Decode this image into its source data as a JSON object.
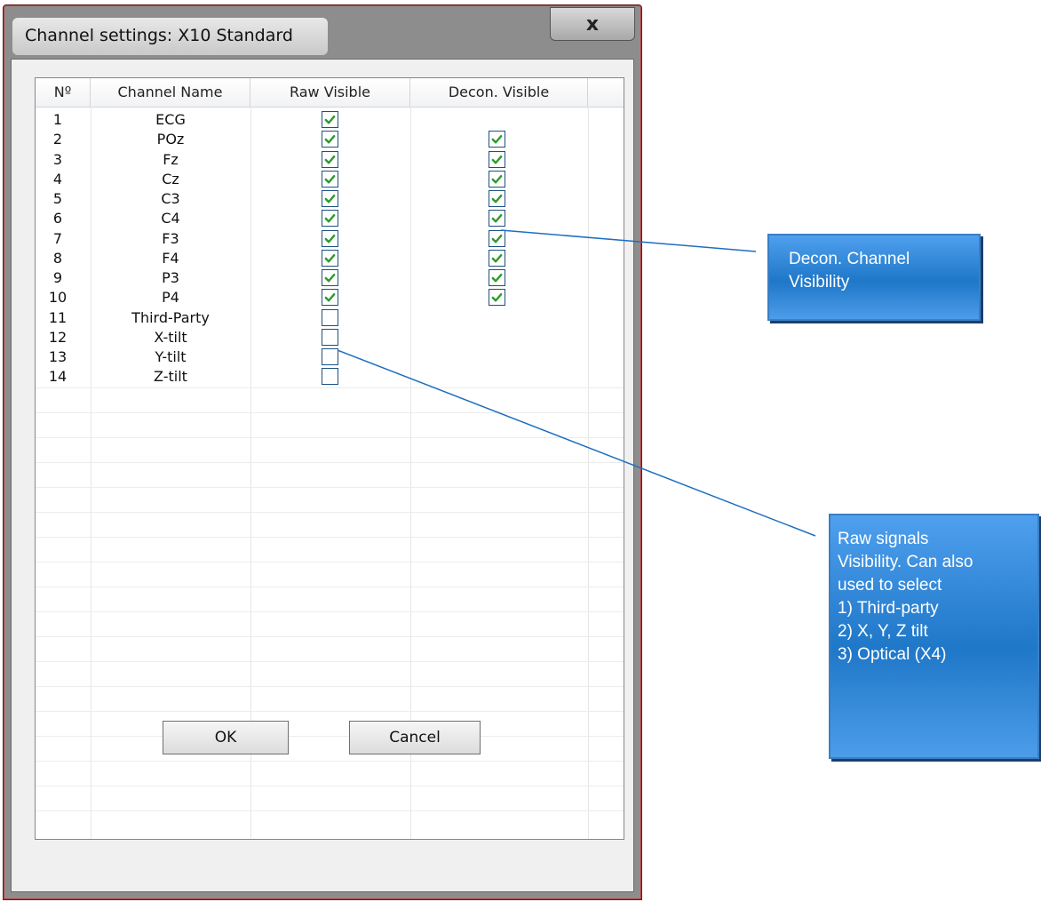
{
  "dialog": {
    "title": "Channel settings: X10 Standard",
    "close_label": "x",
    "ok_label": "OK",
    "cancel_label": "Cancel"
  },
  "table": {
    "columns": [
      "Nº",
      "Channel Name",
      "Raw Visible",
      "Decon. Visible"
    ],
    "rows": [
      {
        "num": "1",
        "name": "ECG",
        "raw": true,
        "decon": null
      },
      {
        "num": "2",
        "name": "POz",
        "raw": true,
        "decon": true
      },
      {
        "num": "3",
        "name": "Fz",
        "raw": true,
        "decon": true
      },
      {
        "num": "4",
        "name": "Cz",
        "raw": true,
        "decon": true
      },
      {
        "num": "5",
        "name": "C3",
        "raw": true,
        "decon": true
      },
      {
        "num": "6",
        "name": "C4",
        "raw": true,
        "decon": true
      },
      {
        "num": "7",
        "name": "F3",
        "raw": true,
        "decon": true
      },
      {
        "num": "8",
        "name": "F4",
        "raw": true,
        "decon": true
      },
      {
        "num": "9",
        "name": "P3",
        "raw": true,
        "decon": true
      },
      {
        "num": "10",
        "name": "P4",
        "raw": true,
        "decon": true
      },
      {
        "num": "11",
        "name": "Third-Party",
        "raw": false,
        "decon": null
      },
      {
        "num": "12",
        "name": "X-tilt",
        "raw": false,
        "decon": null
      },
      {
        "num": "13",
        "name": "Y-tilt",
        "raw": false,
        "decon": null
      },
      {
        "num": "14",
        "name": "Z-tilt",
        "raw": false,
        "decon": null
      }
    ]
  },
  "callouts": {
    "decon": {
      "lines": [
        "Decon. Channel",
        "Visibility"
      ]
    },
    "raw": {
      "lines": [
        "Raw signals",
        "Visibility. Can also",
        "used to select",
        "1) Third-party",
        "2) X, Y, Z tilt",
        "3) Optical (X4)"
      ]
    }
  },
  "colors": {
    "check": "#2e9b2e",
    "checkbox_border": "#1c5180",
    "callout_blue": "#1f77c8",
    "leader_line": "#1f6fc0"
  }
}
